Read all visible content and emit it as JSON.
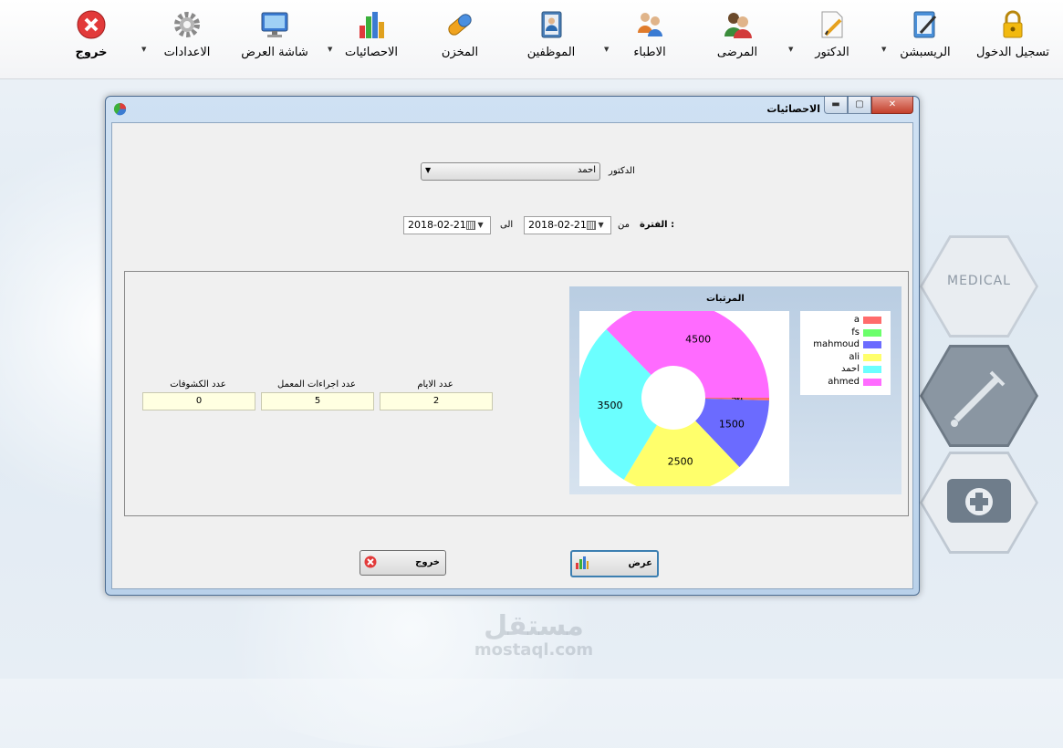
{
  "toolbar": {
    "items": [
      {
        "label": "تسجيل الدخول",
        "icon": "lock-icon",
        "dropdown": false
      },
      {
        "label": "الريسبشن",
        "icon": "notepad-pen-icon",
        "dropdown": true
      },
      {
        "label": "الدكتور",
        "icon": "note-pencil-icon",
        "dropdown": true
      },
      {
        "label": "المرضى",
        "icon": "patients-group-icon",
        "dropdown": false
      },
      {
        "label": "الاطباء",
        "icon": "doctors-group-icon",
        "dropdown": true
      },
      {
        "label": "الموظفين",
        "icon": "address-book-icon",
        "dropdown": false
      },
      {
        "label": "المخزن",
        "icon": "pill-icon",
        "dropdown": false
      },
      {
        "label": "الاحصائيات",
        "icon": "bar-chart-icon",
        "dropdown": true
      },
      {
        "label": "شاشة العرض",
        "icon": "monitor-icon",
        "dropdown": false
      },
      {
        "label": "الاعدادات",
        "icon": "gear-icon",
        "dropdown": true
      },
      {
        "label": "خروج",
        "icon": "exit-x-icon",
        "dropdown": false
      }
    ]
  },
  "window": {
    "title": "الاحصائيات",
    "controls": {
      "minimize": "▬",
      "maximize": "▢",
      "close": "✕"
    }
  },
  "form": {
    "doctor_label": "الدكتور",
    "doctor_value": "احمد",
    "period_label": "الفترة :",
    "from_label": "من",
    "to_label": "الى",
    "from_date": "2018-02-21",
    "to_date": "2018-02-21"
  },
  "stats": {
    "days_label": "عدد الايام",
    "days_value": "2",
    "lab_label": "عدد اجراءات المعمل",
    "lab_value": "5",
    "exams_label": "عدد الكشوفات",
    "exams_value": "0"
  },
  "buttons": {
    "show": "عرض",
    "exit": "خروج"
  },
  "background": {
    "hex_label": "MEDICAL",
    "watermark_ar": "مستقل",
    "watermark_en": "mostaql.com"
  },
  "chart_data": {
    "type": "pie",
    "title": "المرتبات",
    "legend_position": "right",
    "doughnut": true,
    "start_angle_deg": 90,
    "slices": [
      {
        "label": "a",
        "value": 54,
        "color": "#ff6b6b"
      },
      {
        "label": "fs",
        "value": 1,
        "color": "#6bff6b"
      },
      {
        "label": "mahmoud",
        "value": 1500,
        "color": "#6b6bff"
      },
      {
        "label": "ali",
        "value": 2500,
        "color": "#ffff6b"
      },
      {
        "label": "احمد",
        "value": 3500,
        "color": "#6bffff"
      },
      {
        "label": "ahmed",
        "value": 4500,
        "color": "#ff6bff"
      }
    ]
  }
}
